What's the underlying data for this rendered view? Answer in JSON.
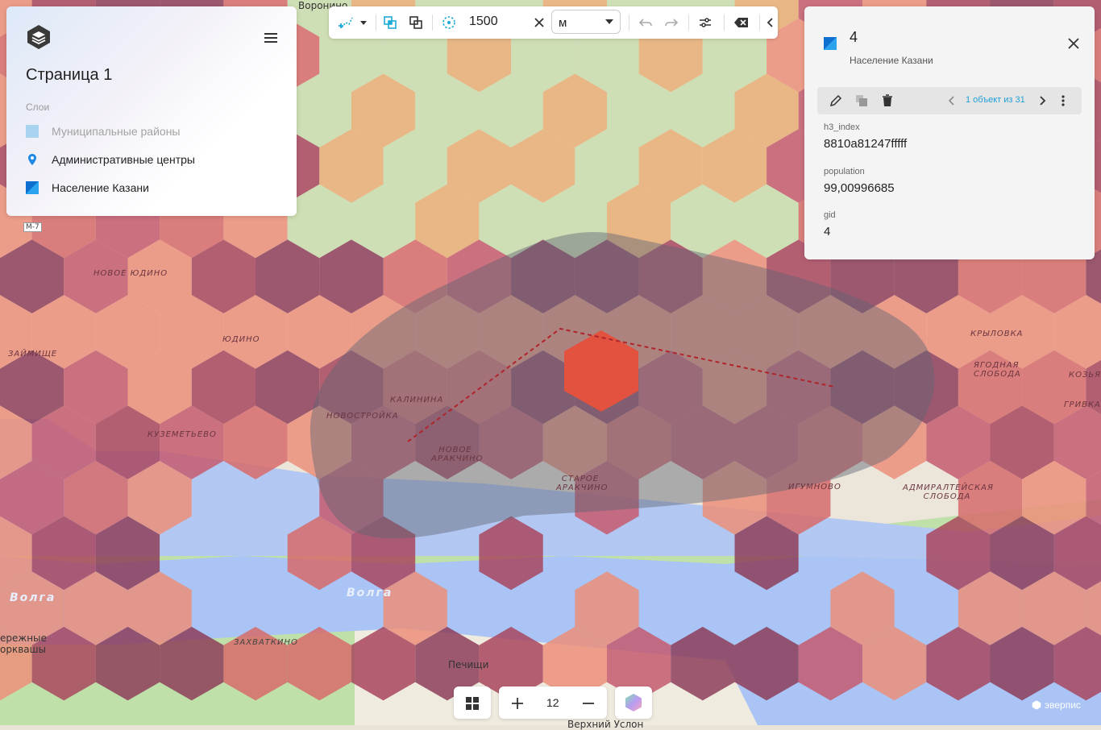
{
  "map": {
    "labels": [
      {
        "id": "voronino",
        "text": "Воронино"
      },
      {
        "id": "novoe-yudino",
        "text": "НОВОЕ ЮДИНО"
      },
      {
        "id": "yudino",
        "text": "ЮДИНО"
      },
      {
        "id": "zaymishche",
        "text": "ЗАЙМИЩЕ"
      },
      {
        "id": "kuzemetevo",
        "text": "КУЗЕМЕТЬЕВО"
      },
      {
        "id": "kalinina",
        "text": "КАЛИНИНА"
      },
      {
        "id": "novostroyka",
        "text": "НОВОСТРОЙКА"
      },
      {
        "id": "novoe-arakchino",
        "text": "НОВОЕ АРАКЧИНО"
      },
      {
        "id": "staroe-arakchino",
        "text": "СТАРОЕ АРАКЧИНО"
      },
      {
        "id": "igumnovo",
        "text": "ИГУМНОВО"
      },
      {
        "id": "admiralteyskaya",
        "text": "АДМИРАЛТЕЙСКАЯ СЛОБОДА"
      },
      {
        "id": "krylovka",
        "text": "КРЫЛОВКА"
      },
      {
        "id": "yagodnaya",
        "text": "ЯГОДНАЯ СЛОБОДА"
      },
      {
        "id": "kozya",
        "text": "КОЗЬЯ"
      },
      {
        "id": "grivka",
        "text": "ГРИВКА"
      },
      {
        "id": "volga-1",
        "text": "Волга"
      },
      {
        "id": "volga-2",
        "text": "Волга"
      },
      {
        "id": "zakhvatkino",
        "text": "ЗАХВАТКИНО"
      },
      {
        "id": "pechishchi",
        "text": "Печищи"
      },
      {
        "id": "naberezhnye",
        "text": "ережные\nорквашы"
      },
      {
        "id": "verkhniy-uslon",
        "text": "Верхний Услон"
      },
      {
        "id": "m7",
        "text": "М-7"
      }
    ]
  },
  "left_panel": {
    "page_title": "Страница 1",
    "layers_caption": "Слои",
    "layers": [
      {
        "label": "Муниципальные районы",
        "color": "#a8d4f2",
        "icon": "polygon-layer-icon",
        "dimmed": true
      },
      {
        "label": "Административные центры",
        "color": "#1e88e5",
        "icon": "map-pin-icon",
        "dimmed": false
      },
      {
        "label": "Население Казани",
        "color": "#1a7fe0",
        "icon": "polygon-layer-icon",
        "dimmed": false
      }
    ]
  },
  "toolbar": {
    "radius_value": "1500",
    "unit_value": "м",
    "icons": [
      "draw-point-icon",
      "dropdown-arrow-icon",
      "intersect-icon",
      "union-icon",
      "radius-icon",
      "clear-icon",
      "undo-icon",
      "redo-icon",
      "settings-icon",
      "delete-icon",
      "collapse-icon"
    ]
  },
  "right_panel": {
    "feature_id": "4",
    "layer_name": "Население Казани",
    "swatch_color": "#1a7fe0",
    "pager": "1 объект из 31",
    "attributes": [
      {
        "key": "h3_index",
        "value": "8810a81247fffff"
      },
      {
        "key": "population",
        "value": "99,00996685"
      },
      {
        "key": "gid",
        "value": "4"
      }
    ]
  },
  "bottom": {
    "zoom_level": "12"
  },
  "attribution": {
    "text": "эверпис"
  }
}
